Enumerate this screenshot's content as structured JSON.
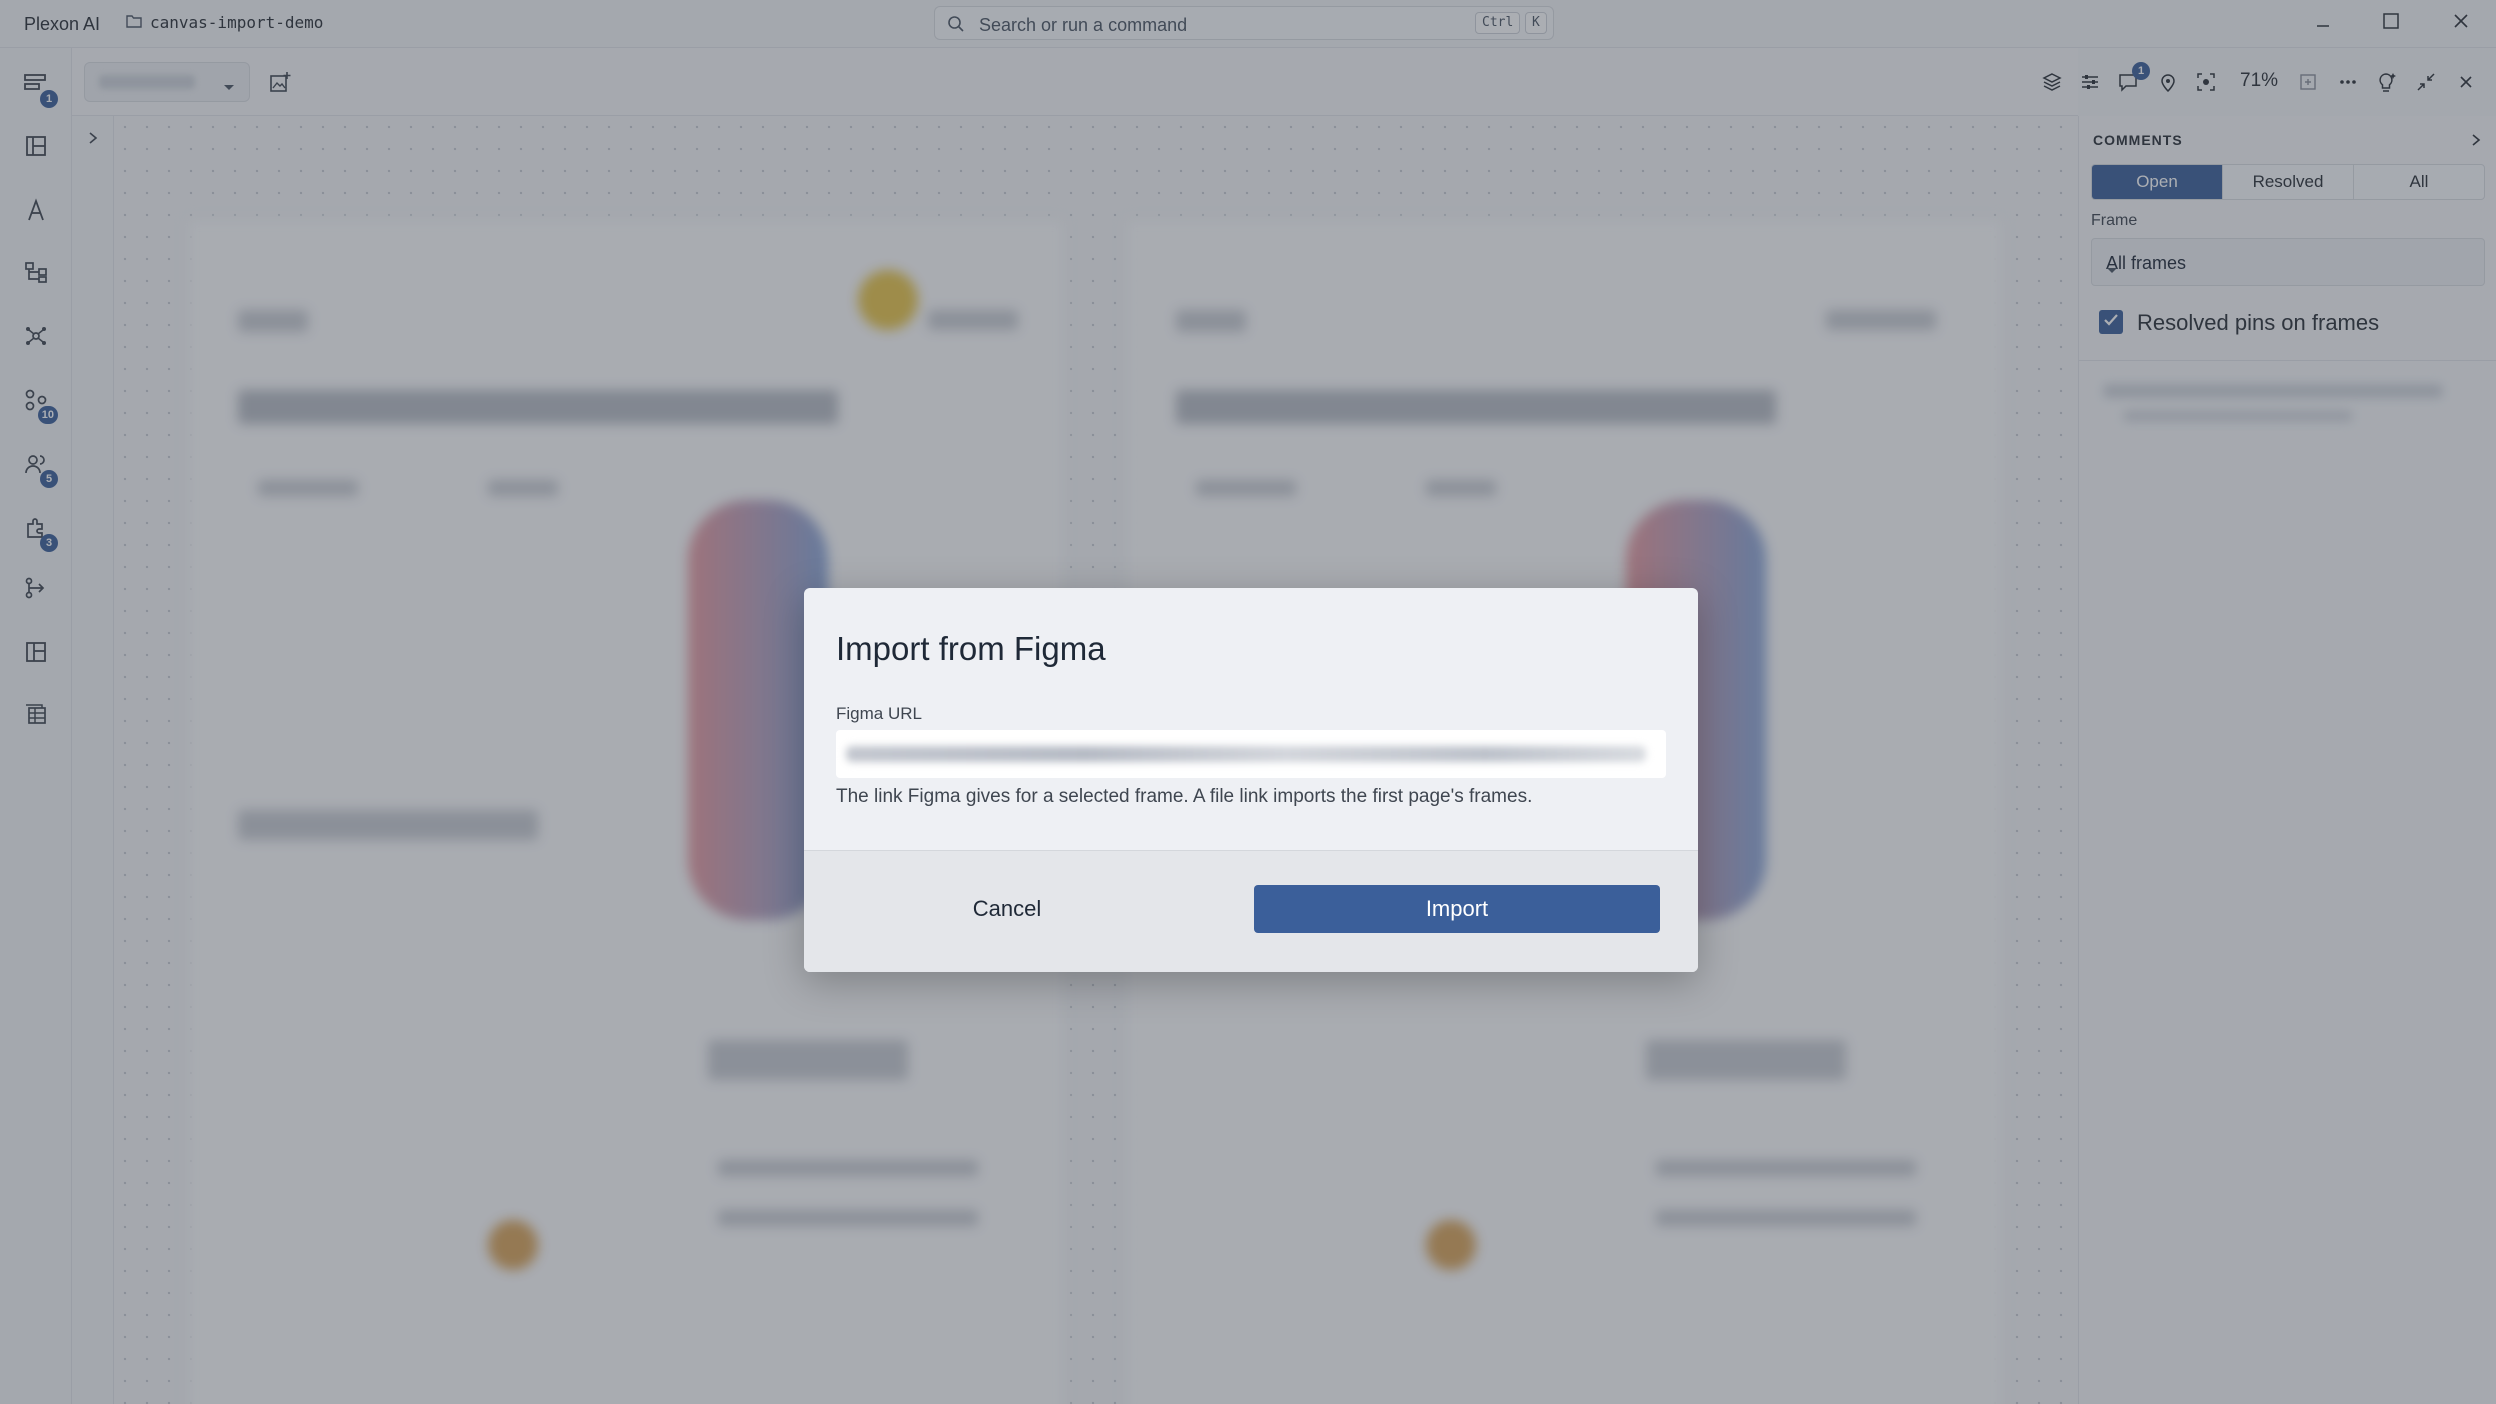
{
  "app": {
    "name": "Plexon AI",
    "workspace": "canvas-import-demo"
  },
  "search": {
    "placeholder": "Search or run a command",
    "shortcut_mod": "Ctrl",
    "shortcut_key": "K"
  },
  "rail": {
    "items": [
      {
        "icon": "pages-icon",
        "badge": "1"
      },
      {
        "icon": "board-icon",
        "badge": ""
      },
      {
        "icon": "pen-tool-icon",
        "badge": ""
      },
      {
        "icon": "hierarchy-icon",
        "badge": ""
      },
      {
        "icon": "network-icon",
        "badge": ""
      },
      {
        "icon": "nodes-icon",
        "badge": "10"
      },
      {
        "icon": "users-icon",
        "badge": "5"
      },
      {
        "icon": "plugins-icon",
        "badge": "3"
      },
      {
        "icon": "flow-icon",
        "badge": ""
      },
      {
        "icon": "layout-icon",
        "badge": ""
      },
      {
        "icon": "table-icon",
        "badge": ""
      }
    ]
  },
  "toolbar": {
    "zoom": "71%",
    "comments_badge": "1"
  },
  "comments": {
    "title": "COMMENTS",
    "tabs": [
      "Open",
      "Resolved",
      "All"
    ],
    "active_tab": "Open",
    "frame_label": "Frame",
    "frame_value": "All frames",
    "resolved_pins_label": "Resolved pins on frames",
    "resolved_pins_checked": true
  },
  "dialog": {
    "title": "Import from Figma",
    "url_label": "Figma URL",
    "hint": "The link Figma gives for a selected frame. A file link imports the first page's frames.",
    "cancel": "Cancel",
    "import": "Import"
  },
  "colors": {
    "accent": "#3b5f9a",
    "overlay": "rgba(55,62,74,0.42)"
  }
}
